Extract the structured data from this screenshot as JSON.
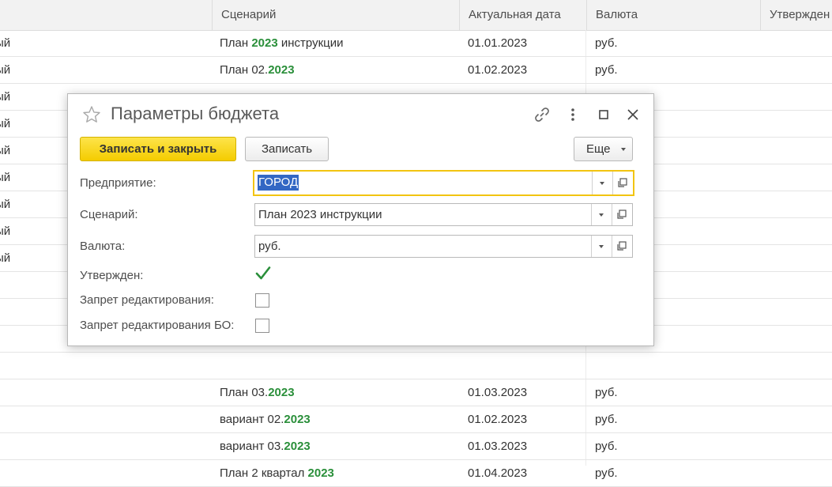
{
  "list": {
    "columns": [
      "",
      "Сценарий",
      "Актуальная дата",
      "Валюта",
      "Утвержден"
    ],
    "rows": [
      {
        "type": "ый",
        "scenario_pre": "План ",
        "scenario_year": "2023",
        "scenario_post": " инструкции",
        "date": "01.01.2023",
        "currency": "руб."
      },
      {
        "type": "ый",
        "scenario_pre": "План 02.",
        "scenario_year": "2023",
        "scenario_post": "",
        "date": "01.02.2023",
        "currency": "руб."
      },
      {
        "type": "ый",
        "scenario_pre": "",
        "scenario_year": "",
        "scenario_post": "",
        "date": "",
        "currency": ""
      },
      {
        "type": "ый",
        "scenario_pre": "",
        "scenario_year": "",
        "scenario_post": "",
        "date": "",
        "currency": ""
      },
      {
        "type": "ый",
        "scenario_pre": "",
        "scenario_year": "",
        "scenario_post": "",
        "date": "",
        "currency": ""
      },
      {
        "type": "ый",
        "scenario_pre": "",
        "scenario_year": "",
        "scenario_post": "",
        "date": "",
        "currency": ""
      },
      {
        "type": "ый",
        "scenario_pre": "",
        "scenario_year": "",
        "scenario_post": "",
        "date": "",
        "currency": ""
      },
      {
        "type": "ый",
        "scenario_pre": "",
        "scenario_year": "",
        "scenario_post": "",
        "date": "",
        "currency": ""
      },
      {
        "type": "ый",
        "scenario_pre": "",
        "scenario_year": "",
        "scenario_post": "",
        "date": "",
        "currency": ""
      },
      {
        "type": "",
        "scenario_pre": "",
        "scenario_year": "",
        "scenario_post": "",
        "date": "",
        "currency": ""
      },
      {
        "type": "",
        "scenario_pre": "",
        "scenario_year": "",
        "scenario_post": "",
        "date": "",
        "currency": ""
      },
      {
        "type": "",
        "scenario_pre": "",
        "scenario_year": "",
        "scenario_post": "",
        "date": "",
        "currency": ""
      },
      {
        "type": "",
        "scenario_pre": "",
        "scenario_year": "",
        "scenario_post": "",
        "date": "",
        "currency": ""
      },
      {
        "type": "",
        "scenario_pre": "План 03.",
        "scenario_year": "2023",
        "scenario_post": "",
        "date": "01.03.2023",
        "currency": "руб."
      },
      {
        "type": "",
        "scenario_pre": "вариант 02.",
        "scenario_year": "2023",
        "scenario_post": "",
        "date": "01.02.2023",
        "currency": "руб."
      },
      {
        "type": "",
        "scenario_pre": "вариант 03.",
        "scenario_year": "2023",
        "scenario_post": "",
        "date": "01.03.2023",
        "currency": "руб."
      },
      {
        "type": "",
        "scenario_pre": "План 2 квартал ",
        "scenario_year": "2023",
        "scenario_post": "",
        "date": "01.04.2023",
        "currency": "руб."
      }
    ],
    "colors": {
      "year": "#2a8f3a"
    }
  },
  "dialog": {
    "title": "Параметры бюджета",
    "buttons": {
      "save_close": "Записать и закрыть",
      "save": "Записать",
      "more": "Еще"
    },
    "fields": {
      "enterprise_label": "Предприятие:",
      "enterprise_value": "ГОРОД",
      "scenario_label": "Сценарий:",
      "scenario_value": "План 2023 инструкции",
      "currency_label": "Валюта:",
      "currency_value": "руб.",
      "approved_label": "Утвержден:",
      "approved": true,
      "edit_lock_label": "Запрет редактирования:",
      "edit_lock": false,
      "edit_lock_bo_label": "Запрет редактирования БО:",
      "edit_lock_bo": false
    },
    "icons": [
      "star-icon",
      "link-icon",
      "more-vertical-icon",
      "maximize-icon",
      "close-icon",
      "dropdown-icon",
      "open-icon",
      "checkmark-icon"
    ],
    "colors": {
      "primary_button": "#f9d71c",
      "focus_border": "#f2c411",
      "selection": "#3367c4",
      "checkmark": "#2a8f3a"
    }
  }
}
